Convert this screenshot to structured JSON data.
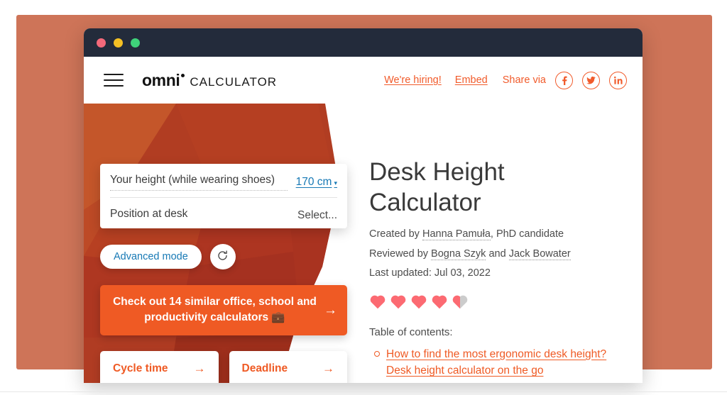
{
  "window": {
    "traffic_lights": [
      "close",
      "minimize",
      "maximize"
    ]
  },
  "header": {
    "menu_icon": "hamburger-icon",
    "brand_primary": "omni",
    "brand_secondary": "CALCULATOR",
    "hiring_label": "We're hiring!",
    "embed_label": "Embed",
    "share_label": "Share via",
    "social": [
      {
        "name": "facebook-icon",
        "glyph": "f"
      },
      {
        "name": "twitter-icon",
        "glyph": "t"
      },
      {
        "name": "linkedin-icon",
        "glyph": "in"
      }
    ]
  },
  "calculator": {
    "rows": [
      {
        "label": "Your height (while wearing shoes)",
        "value": "170 cm",
        "value_type": "link",
        "caret": "▾"
      },
      {
        "label": "Position at desk",
        "value": "Select...",
        "value_type": "placeholder",
        "caret": ""
      }
    ],
    "advanced_mode_label": "Advanced mode",
    "reset_icon": "reset-icon",
    "similar_banner": {
      "text": "Check out 14 similar office, school and productivity calculators 💼",
      "arrow": "→"
    },
    "related": [
      {
        "label": "Cycle time",
        "arrow": "→"
      },
      {
        "label": "Deadline",
        "arrow": "→"
      }
    ]
  },
  "article": {
    "title": "Desk Height Calculator",
    "created_prefix": "Created by ",
    "created_author": "Hanna Pamuła",
    "created_suffix": ", PhD candidate",
    "reviewed_prefix": "Reviewed by ",
    "reviewer_one": "Bogna Szyk",
    "reviewed_conjunction": " and ",
    "reviewer_two": "Jack Bowater",
    "last_updated": "Last updated: Jul 03, 2022",
    "rating": {
      "value": 4.5,
      "max": 5,
      "full_hearts": 4,
      "half_hearts": 1,
      "filled_color": "#fc6a72",
      "empty_color": "#cccccc"
    },
    "toc_title": "Table of contents:",
    "toc_items": [
      "How to find the most ergonomic desk height? Desk height calculator on the go"
    ]
  },
  "colors": {
    "page_background": "#ffffff",
    "panel_salmon": "#ce7458",
    "titlebar": "#232b3b",
    "hero_light": "#c4562a",
    "hero_mid": "#b13d22",
    "hero_dark": "#9e2f1c",
    "accent_orange": "#ef5a24",
    "link_blue": "#1779b5",
    "heading_gray": "#3a3a3a"
  }
}
